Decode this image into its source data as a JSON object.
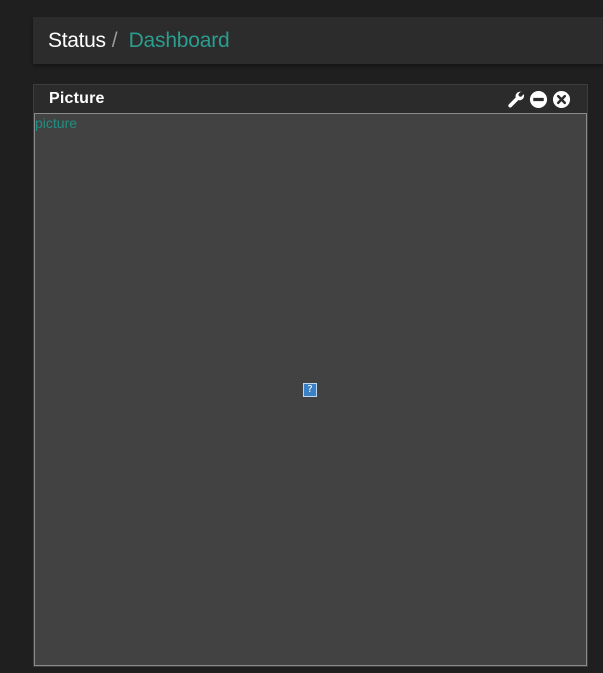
{
  "breadcrumb": {
    "root": "Status",
    "separator": "/",
    "current": "Dashboard"
  },
  "widget": {
    "title": "Picture",
    "image_alt": "picture",
    "broken_image_glyph": "?",
    "tools": {
      "settings_icon": "wrench-icon",
      "minimize_icon": "minus-circle-icon",
      "close_icon": "close-circle-icon"
    }
  },
  "colors": {
    "accent": "#2a9d8f",
    "background": "#1f1f1f",
    "header": "#2c2c2c",
    "panel_body": "#424242"
  }
}
